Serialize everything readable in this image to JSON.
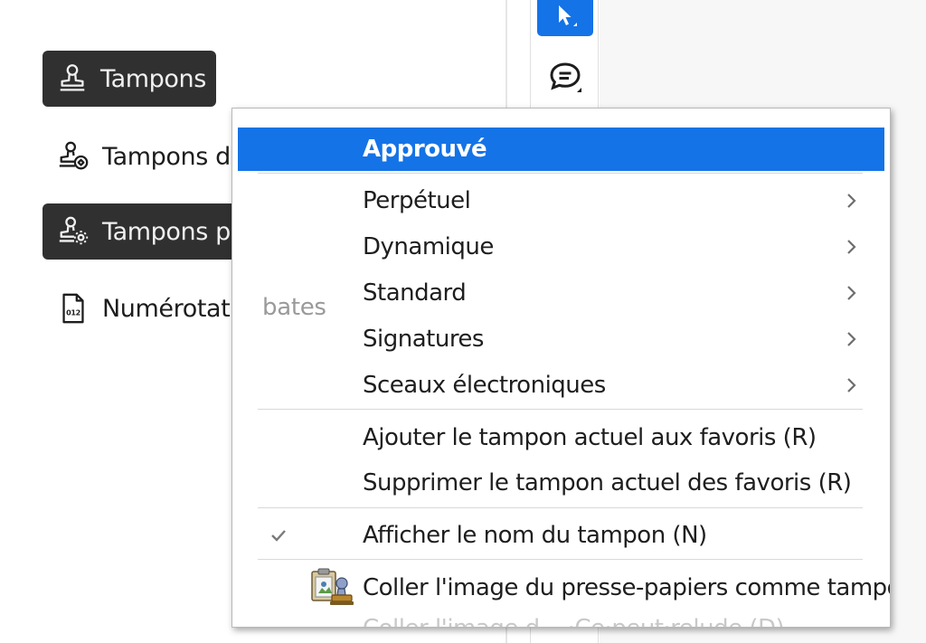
{
  "left_panel": {
    "items": [
      {
        "label": "Tampons",
        "icon": "stamp-icon",
        "selected": true
      },
      {
        "label": "Tampons d'u",
        "icon": "custom-stamp-icon",
        "selected": false
      },
      {
        "label": "Tampons pe",
        "icon": "stamp-settings-icon",
        "selected": true
      },
      {
        "label": "Numérotatio",
        "icon": "bates-numbering-icon",
        "selected": false
      }
    ]
  },
  "toolbar": {
    "select_tool": "select-arrow-icon",
    "comment_tool": "comment-icon"
  },
  "menu": {
    "ghost_text": "bates",
    "items": [
      {
        "label": "Approuvé",
        "highlighted": true
      },
      {
        "label": "Perpétuel",
        "submenu": true
      },
      {
        "label": "Dynamique",
        "submenu": true
      },
      {
        "label": "Standard",
        "submenu": true
      },
      {
        "label": "Signatures",
        "submenu": true
      },
      {
        "label": "Sceaux électroniques",
        "submenu": true
      },
      {
        "label": "Ajouter le tampon actuel aux favoris (R)"
      },
      {
        "label": "Supprimer le tampon actuel des favoris (R)"
      },
      {
        "label": "Afficher le nom du tampon (N)",
        "checked": true
      },
      {
        "label": "Coller l'image du presse-papiers comme tampon (D)",
        "icon": "paste-stamp-icon"
      }
    ],
    "cut_off_text": "Coller l'image d...  ·Ce·peut·relude (D)"
  },
  "colors": {
    "accent": "#1473e6",
    "selected_bg": "#303030",
    "menu_border": "#b9b9b9"
  }
}
